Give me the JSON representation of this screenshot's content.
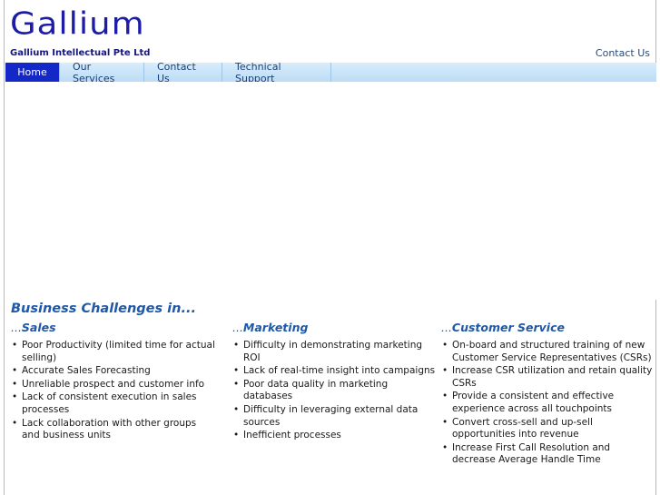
{
  "header": {
    "logo_text": "Gallium",
    "company_name": "Gallium Intellectual Pte Ltd",
    "contact_link": "Contact Us"
  },
  "nav": {
    "items": [
      {
        "label": "Home",
        "active": true
      },
      {
        "label": "Our Services",
        "active": false
      },
      {
        "label": "Contact Us",
        "active": false
      },
      {
        "label": "Technical Support",
        "active": false
      }
    ]
  },
  "content": {
    "section_title": "Business Challenges in...",
    "columns": [
      {
        "prefix": "...",
        "heading": "Sales",
        "items": [
          "Poor Productivity (limited time for actual selling)",
          "Accurate Sales Forecasting",
          "Unreliable prospect and customer info",
          "Lack of consistent execution in sales processes",
          "Lack collaboration with other groups and business units"
        ]
      },
      {
        "prefix": "...",
        "heading": "Marketing",
        "items": [
          "Difficulty in demonstrating marketing ROI",
          "Lack of real-time insight into campaigns",
          "Poor data quality in marketing databases",
          "Difficulty in leveraging external data sources",
          "Inefficient processes"
        ]
      },
      {
        "prefix": "...",
        "heading": "Customer Service",
        "items": [
          "On-board and structured training of new Customer Service Representatives (CSRs)",
          "Increase CSR utilization and retain quality CSRs",
          "Provide a consistent and effective experience across all touchpoints",
          "Convert cross-sell and up-sell opportunities into revenue",
          "Increase First Call Resolution and decrease Average Handle Time"
        ]
      }
    ]
  },
  "colors": {
    "logo": "#1c1ca8",
    "nav_active": "#1428c8",
    "heading": "#1f58a8"
  }
}
